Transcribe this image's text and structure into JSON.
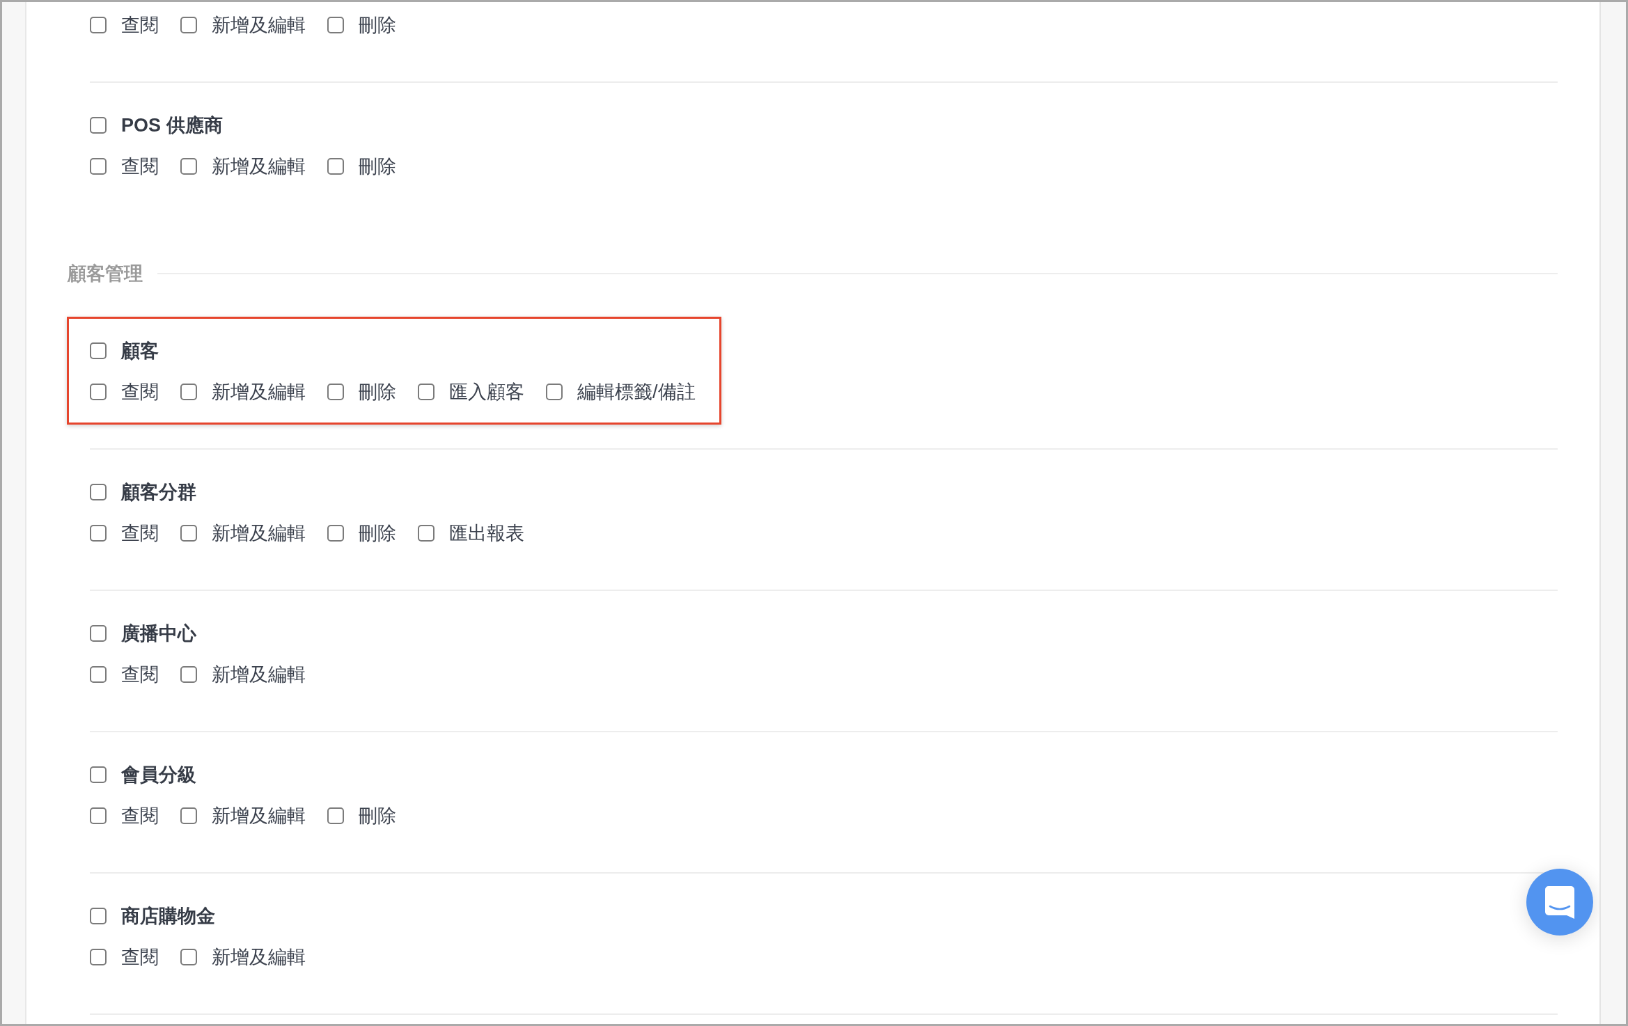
{
  "sections": [
    {
      "items": [
        {
          "highlighted": false,
          "permissions": [
            {
              "label": "查閱",
              "checked": false
            },
            {
              "label": "新增及編輯",
              "checked": false
            },
            {
              "label": "刪除",
              "checked": false
            }
          ]
        },
        {
          "name": "POS 供應商",
          "checked": false,
          "highlighted": false,
          "permissions": [
            {
              "label": "查閱",
              "checked": false
            },
            {
              "label": "新增及編輯",
              "checked": false
            },
            {
              "label": "刪除",
              "checked": false
            }
          ]
        }
      ]
    },
    {
      "title": "顧客管理",
      "items": [
        {
          "name": "顧客",
          "checked": false,
          "highlighted": true,
          "permissions": [
            {
              "label": "查閱",
              "checked": false
            },
            {
              "label": "新增及編輯",
              "checked": false
            },
            {
              "label": "刪除",
              "checked": false
            },
            {
              "label": "匯入顧客",
              "checked": false
            },
            {
              "label": "編輯標籤/備註",
              "checked": false
            }
          ]
        },
        {
          "name": "顧客分群",
          "checked": false,
          "highlighted": false,
          "permissions": [
            {
              "label": "查閱",
              "checked": false
            },
            {
              "label": "新增及編輯",
              "checked": false
            },
            {
              "label": "刪除",
              "checked": false
            },
            {
              "label": "匯出報表",
              "checked": false
            }
          ]
        },
        {
          "name": "廣播中心",
          "checked": false,
          "highlighted": false,
          "permissions": [
            {
              "label": "查閱",
              "checked": false
            },
            {
              "label": "新增及編輯",
              "checked": false
            }
          ]
        },
        {
          "name": "會員分級",
          "checked": false,
          "highlighted": false,
          "permissions": [
            {
              "label": "查閱",
              "checked": false
            },
            {
              "label": "新增及編輯",
              "checked": false
            },
            {
              "label": "刪除",
              "checked": false
            }
          ]
        },
        {
          "name": "商店購物金",
          "checked": false,
          "highlighted": false,
          "permissions": [
            {
              "label": "查閱",
              "checked": false
            },
            {
              "label": "新增及編輯",
              "checked": false
            }
          ]
        }
      ]
    }
  ]
}
